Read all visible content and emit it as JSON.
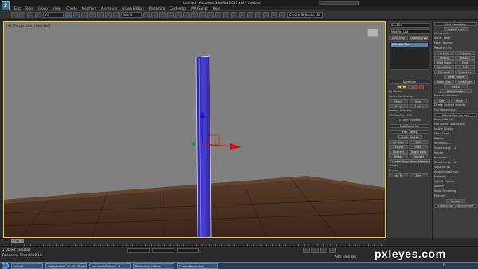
{
  "app": {
    "title": "Untitled - Autodesk 3ds Max 2011 x64 - Untitled",
    "logo_text": "3",
    "search_placeholder": "Type a keyword or phrase"
  },
  "menu": [
    "Edit",
    "Tools",
    "Group",
    "Views",
    "Create",
    "Modifiers",
    "Animation",
    "Graph Editors",
    "Rendering",
    "Customize",
    "MAXScript",
    "Help"
  ],
  "toolbar": {
    "selection_filter": "All",
    "reference_coord": "World",
    "named_selection": "Create Selection Se"
  },
  "viewport": {
    "label": "[+] [Perspective] [Realistic]",
    "border_color": "#f0d020"
  },
  "command_panel": {
    "object_name": "Box001",
    "modifier_list": "Modifier List",
    "btn_unwrap": "UVW Map",
    "btn_cloth": "Unwrap UVW",
    "stack_item": "Editable Poly",
    "selection_header": "Selection",
    "by_vertex": "By Vertex",
    "ignore_backfacing": "Ignore Backfacing",
    "shrink": "Shrink",
    "grow": "Grow",
    "ring": "Ring",
    "loop": "Loop",
    "preview_selection": "Preview Selection",
    "off": "Off",
    "subobj": "SubObj",
    "multi": "Multi",
    "selected_count": "0 Edges Selected",
    "soft_selection": "Soft Selection",
    "edit_edges": "Edit Edges",
    "insert_vertex": "Insert Vertex",
    "remove": "Remove",
    "split": "Split",
    "extrude": "Extrude",
    "weld": "Weld",
    "chamfer": "Chamfer",
    "target_weld": "Target Weld",
    "bridge": "Bridge",
    "connect": "Connect",
    "create_shape": "Create Shape From Selection",
    "weight": "Weight:",
    "crease": "Crease:",
    "edit_tri": "Edit Tri.",
    "turn": "Turn"
  },
  "right_panel": {
    "edit_geometry": "Edit Geometry",
    "repeat_last": "Repeat Last",
    "constraints": "Constraints",
    "none": "None",
    "edge": "Edge",
    "face": "Face",
    "normal": "Normal",
    "preserve_uvs": "Preserve UVs",
    "create": "Create",
    "collapse": "Collapse",
    "attach": "Attach",
    "detach": "Detach",
    "slice_plane": "Slice Plane",
    "split": "Split",
    "quickslice": "QuickSlice",
    "cut": "Cut",
    "msmooth": "MSmooth",
    "tessellate": "Tessellate",
    "make_planar": "Make Planar",
    "view_align": "View Align",
    "grid_align": "Grid Align",
    "relax": "Relax",
    "hide_selected": "Hide Selected",
    "subdivision_selection": "Named Selections:",
    "copy": "Copy",
    "paste": "Paste",
    "delete_isolated": "Delete Isolated Vertices",
    "full_interactivity": "Full Interactivity",
    "subdivision_surface": "Subdivision Surface",
    "smooth_result": "Smooth Result",
    "use_nurms": "Use NURMS Subdivision",
    "isoline_display": "Isoline Display",
    "show_cage": "Show Cage......",
    "display": "Display",
    "iterations1": "Iterations:",
    "iterations1_val": "1",
    "smoothness1": "Smoothness:",
    "smoothness1_val": "1,0",
    "render": "Render",
    "iterations2": "Iterations:",
    "iterations2_val": "0",
    "smoothness2": "Smoothness:",
    "smoothness2_val": "1,0",
    "separate_by": "Separate By",
    "smoothing_groups": "Smoothing Groups",
    "materials": "Materials",
    "update_options": "Update Options",
    "always": "Always",
    "when_rendering": "When Rendering",
    "manually": "Manually",
    "update": "Update",
    "subdivision_displacement": "Subdivision Displacement"
  },
  "timeline": {
    "slider": "0 / 100"
  },
  "status": {
    "line1": "1 Object Selected",
    "line2": "Rendering Time: 0:00:10",
    "set_key": "Add Time Tag"
  },
  "taskbar": {
    "items": [
      "Wrzuta",
      "Odkrywanie - Mozilla Firefox",
      "tworzenieSP.max - A...",
      "Photoshop picture...",
      "Computer_maker_1..."
    ],
    "tray": "PL"
  },
  "watermark": "pxleyes.com",
  "colors": {
    "viewport_bg": "#808080",
    "floor": "#4e3324",
    "box_blue": "#3a2fb8",
    "selected_blue": "#5a7fa8"
  }
}
